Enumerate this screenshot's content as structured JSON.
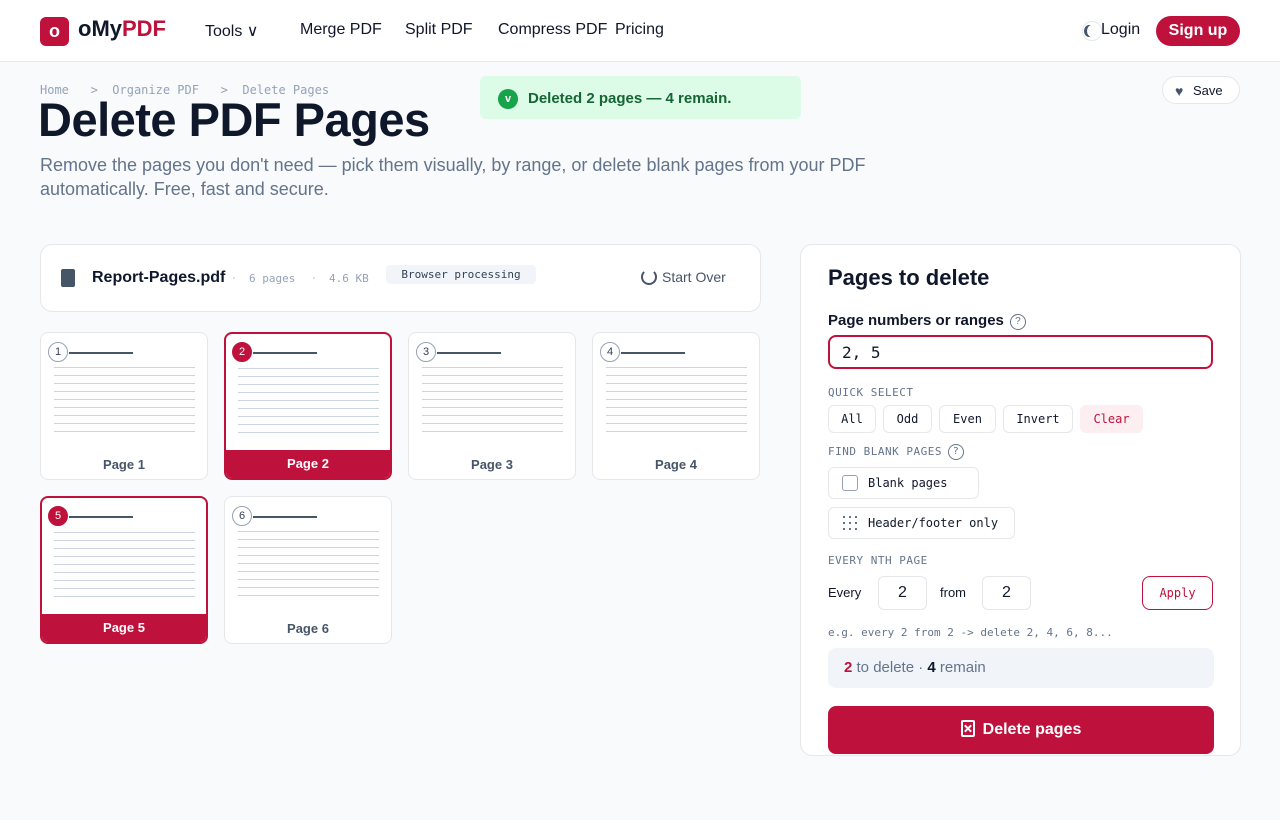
{
  "header": {
    "logo_mark": "o",
    "logo_text_a": "oMy",
    "logo_text_b": "PDF",
    "nav": [
      {
        "label": "Tools ∨"
      },
      {
        "label": "Merge PDF"
      },
      {
        "label": "Split PDF"
      },
      {
        "label": "Compress PDF"
      },
      {
        "label": "Pricing"
      }
    ],
    "theme_icon": "moon-icon",
    "login_label": "Login",
    "signup_label": "Sign up"
  },
  "breadcrumb": [
    "Home",
    "Organize PDF",
    "Delete Pages"
  ],
  "breadcrumb_sep": ">",
  "page": {
    "title": "Delete PDF Pages",
    "subtitle": "Remove the pages you don't need — pick them visually, by range, or delete blank pages from your PDF automatically. Free, fast and secure."
  },
  "toast": {
    "icon": "v",
    "text": "Deleted 2 pages — 4 remain."
  },
  "save": {
    "label": "Save",
    "icon": "heart-icon"
  },
  "file": {
    "name": "Report-Pages.pdf",
    "pages": "6 pages",
    "size": "4.6 KB",
    "sep": "·",
    "badge": "Browser processing",
    "start_over": "Start Over"
  },
  "pages": [
    {
      "num": "1",
      "label": "Page 1",
      "selected": false
    },
    {
      "num": "2",
      "label": "Page 2",
      "selected": true
    },
    {
      "num": "3",
      "label": "Page 3",
      "selected": false
    },
    {
      "num": "4",
      "label": "Page 4",
      "selected": false
    },
    {
      "num": "5",
      "label": "Page 5",
      "selected": true
    },
    {
      "num": "6",
      "label": "Page 6",
      "selected": false
    }
  ],
  "panel": {
    "title": "Pages to delete",
    "range_label": "Page numbers or ranges",
    "help": "?",
    "range_value": "2, 5",
    "quick_select_label": "QUICK SELECT",
    "quick_select": [
      "All",
      "Odd",
      "Even",
      "Invert",
      "Clear"
    ],
    "find_blank_label": "FIND BLANK PAGES",
    "blank_option": "Blank pages",
    "header_footer_option": "Header/footer only",
    "nth_label": "EVERY NTH PAGE",
    "every_label": "Every",
    "every_value": "2",
    "from_label": "from",
    "from_value": "2",
    "apply_label": "Apply",
    "example": "e.g. every 2 from 2 -> delete 2, 4, 6, 8...",
    "summary": {
      "delete_count": "2",
      "delete_text": "to delete",
      "dot": "·",
      "remain_count": "4",
      "remain_text": "remain"
    },
    "delete_button": "Delete pages"
  },
  "colors": {
    "accent": "#be123c",
    "success": "#16a34a",
    "success_bg": "#dcfce7"
  }
}
